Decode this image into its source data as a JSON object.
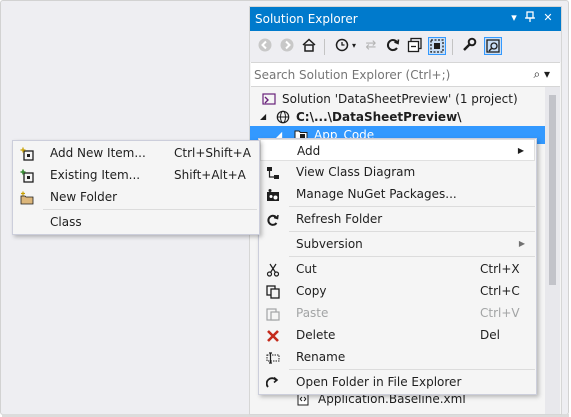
{
  "solution_explorer": {
    "title": "Solution Explorer",
    "controls": [
      "pin-icon",
      "close-icon"
    ],
    "search_placeholder": "Search Solution Explorer (Ctrl+;)",
    "tree": {
      "solution": "Solution 'DataSheetPreview' (1 project)",
      "project": "C:\\...\\DataSheetPreview\\",
      "folder": "App_Code",
      "partial_item": "Application.Baseline.xml"
    }
  },
  "context_menu": {
    "add": "Add",
    "view_class_diagram": "View Class Diagram",
    "manage_nuget": "Manage NuGet Packages...",
    "refresh_folder": "Refresh Folder",
    "subversion": "Subversion",
    "cut": "Cut",
    "cut_shortcut": "Ctrl+X",
    "copy": "Copy",
    "copy_shortcut": "Ctrl+C",
    "paste": "Paste",
    "paste_shortcut": "Ctrl+V",
    "delete": "Delete",
    "delete_shortcut": "Del",
    "rename": "Rename",
    "open_folder": "Open Folder in File Explorer"
  },
  "add_submenu": {
    "new_item": "Add New Item...",
    "new_item_shortcut": "Ctrl+Shift+A",
    "existing_item": "Existing Item...",
    "existing_item_shortcut": "Shift+Alt+A",
    "new_folder": "New Folder",
    "class": "Class"
  },
  "colors": {
    "title_bar": "#007acc",
    "selection": "#3399ff",
    "delete_icon": "#c42b1c"
  }
}
